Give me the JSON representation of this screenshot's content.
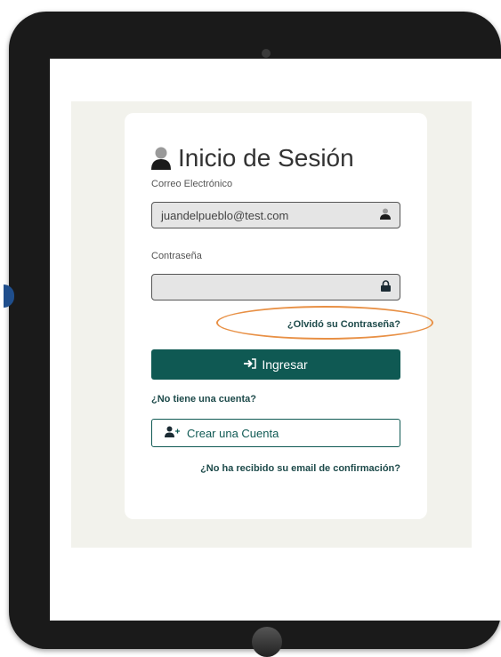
{
  "login": {
    "title": "Inicio de Sesión",
    "email_label": "Correo Electrónico",
    "email_value": "juandelpueblo@test.com",
    "password_label": "Contraseña",
    "password_value": "",
    "forgot_link": "¿Olvidó su Contraseña?",
    "login_button": "Ingresar",
    "no_account_text": "¿No tiene una cuenta?",
    "create_account_button": "Crear una Cuenta",
    "resend_link": "¿No ha recibido su email de confirmación?"
  },
  "colors": {
    "primary": "#0f5953",
    "highlight_circle": "#e89045",
    "band": "#f2f2ec",
    "device": "#1a1a1a"
  },
  "icons": {
    "title": "user-icon",
    "email_field": "user-icon",
    "password_field": "lock-icon",
    "login_button": "sign-in-icon",
    "create_account_button": "user-plus-icon"
  }
}
